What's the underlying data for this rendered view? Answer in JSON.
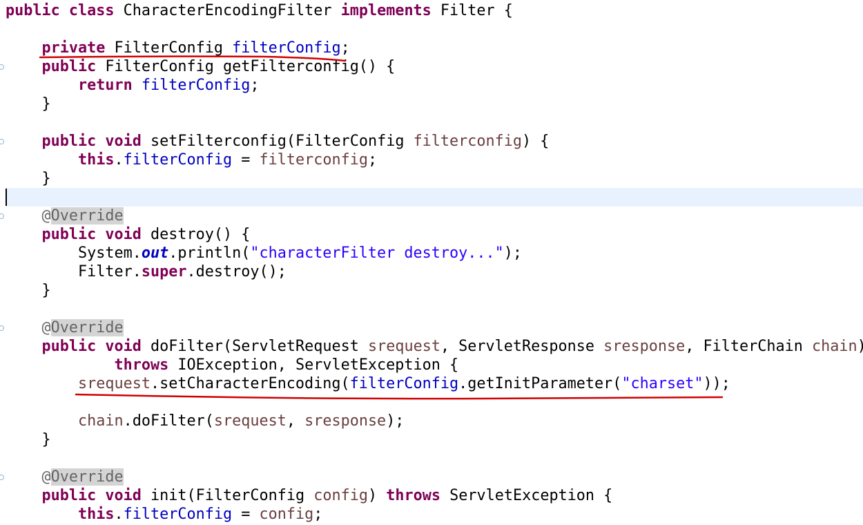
{
  "editor": {
    "code_lines": [
      [
        [
          "kw",
          "public"
        ],
        [
          "p",
          " "
        ],
        [
          "kw",
          "class"
        ],
        [
          "p",
          " CharacterEncodingFilter "
        ],
        [
          "kw",
          "implements"
        ],
        [
          "p",
          " Filter {"
        ]
      ],
      [],
      [
        [
          "p",
          "    "
        ],
        [
          "kw",
          "private"
        ],
        [
          "p",
          " FilterConfig "
        ],
        [
          "fld",
          "filterConfig"
        ],
        [
          "p",
          ";"
        ]
      ],
      [
        [
          "p",
          "    "
        ],
        [
          "kw",
          "public"
        ],
        [
          "p",
          " FilterConfig getFilterconfig() {"
        ]
      ],
      [
        [
          "p",
          "        "
        ],
        [
          "kw",
          "return"
        ],
        [
          "p",
          " "
        ],
        [
          "fld",
          "filterConfig"
        ],
        [
          "p",
          ";"
        ]
      ],
      [
        [
          "p",
          "    }"
        ]
      ],
      [],
      [
        [
          "p",
          "    "
        ],
        [
          "kw",
          "public"
        ],
        [
          "p",
          " "
        ],
        [
          "kw",
          "void"
        ],
        [
          "p",
          " setFilterconfig(FilterConfig "
        ],
        [
          "var",
          "filterconfig"
        ],
        [
          "p",
          ") {"
        ]
      ],
      [
        [
          "p",
          "        "
        ],
        [
          "kw",
          "this"
        ],
        [
          "p",
          "."
        ],
        [
          "fld",
          "filterConfig"
        ],
        [
          "p",
          " = "
        ],
        [
          "var",
          "filterconfig"
        ],
        [
          "p",
          ";"
        ]
      ],
      [
        [
          "p",
          "    }"
        ]
      ],
      [],
      [
        [
          "p",
          "    "
        ],
        [
          "annat",
          "@"
        ],
        [
          "ann",
          "Override"
        ]
      ],
      [
        [
          "p",
          "    "
        ],
        [
          "kw",
          "public"
        ],
        [
          "p",
          " "
        ],
        [
          "kw",
          "void"
        ],
        [
          "p",
          " destroy() {"
        ]
      ],
      [
        [
          "p",
          "        System."
        ],
        [
          "sfld",
          "out"
        ],
        [
          "p",
          ".println("
        ],
        [
          "str",
          "\"characterFilter destroy...\""
        ],
        [
          "p",
          ");"
        ]
      ],
      [
        [
          "p",
          "        Filter."
        ],
        [
          "kw",
          "super"
        ],
        [
          "p",
          ".destroy();"
        ]
      ],
      [
        [
          "p",
          "    }"
        ]
      ],
      [],
      [
        [
          "p",
          "    "
        ],
        [
          "annat",
          "@"
        ],
        [
          "ann",
          "Override"
        ]
      ],
      [
        [
          "p",
          "    "
        ],
        [
          "kw",
          "public"
        ],
        [
          "p",
          " "
        ],
        [
          "kw",
          "void"
        ],
        [
          "p",
          " doFilter(ServletRequest "
        ],
        [
          "var",
          "srequest"
        ],
        [
          "p",
          ", ServletResponse "
        ],
        [
          "var",
          "sresponse"
        ],
        [
          "p",
          ", FilterChain "
        ],
        [
          "var",
          "chain"
        ],
        [
          "p",
          ")"
        ]
      ],
      [
        [
          "p",
          "            "
        ],
        [
          "kw",
          "throws"
        ],
        [
          "p",
          " IOException, ServletException {"
        ]
      ],
      [
        [
          "p",
          "        "
        ],
        [
          "var",
          "srequest"
        ],
        [
          "p",
          ".setCharacterEncoding("
        ],
        [
          "fld",
          "filterConfig"
        ],
        [
          "p",
          ".getInitParameter("
        ],
        [
          "str",
          "\"charset\""
        ],
        [
          "p",
          "));"
        ]
      ],
      [],
      [
        [
          "p",
          "        "
        ],
        [
          "var",
          "chain"
        ],
        [
          "p",
          ".doFilter("
        ],
        [
          "var",
          "srequest"
        ],
        [
          "p",
          ", "
        ],
        [
          "var",
          "sresponse"
        ],
        [
          "p",
          ");"
        ]
      ],
      [
        [
          "p",
          "    }"
        ]
      ],
      [],
      [
        [
          "p",
          "    "
        ],
        [
          "annat",
          "@"
        ],
        [
          "ann",
          "Override"
        ]
      ],
      [
        [
          "p",
          "    "
        ],
        [
          "kw",
          "public"
        ],
        [
          "p",
          " "
        ],
        [
          "kw",
          "void"
        ],
        [
          "p",
          " init(FilterConfig "
        ],
        [
          "var",
          "config"
        ],
        [
          "p",
          ") "
        ],
        [
          "kw",
          "throws"
        ],
        [
          "p",
          " ServletException {"
        ]
      ],
      [
        [
          "p",
          "        "
        ],
        [
          "kw",
          "this"
        ],
        [
          "p",
          "."
        ],
        [
          "fld",
          "filterConfig"
        ],
        [
          "p",
          " = "
        ],
        [
          "var",
          "config"
        ],
        [
          "p",
          ";"
        ]
      ]
    ],
    "colors": {
      "keyword": "#7f0055",
      "field": "#0000c0",
      "local_variable": "#6a3e3e",
      "string": "#2a00ff",
      "annotation": "#646464",
      "current_line": "#e8f2fe",
      "annotation_highlight": "#d4d4d4",
      "red_underline": "#d00000"
    },
    "red_underline_annotations": [
      {
        "line": 3,
        "note": "field declaration underlined"
      },
      {
        "line": 21,
        "note": "setCharacterEncoding call underlined"
      }
    ]
  }
}
